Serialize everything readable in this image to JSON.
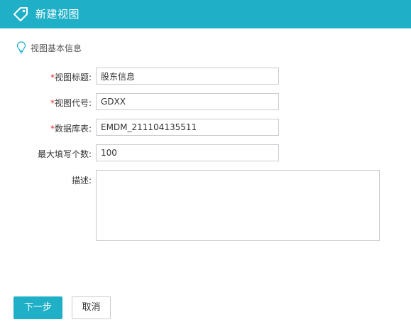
{
  "header": {
    "title": "新建视图",
    "icon": "tag-icon"
  },
  "section": {
    "title": "视图基本信息",
    "icon": "lightbulb-icon"
  },
  "form": {
    "required_mark": "*",
    "view_title": {
      "label": "视图标题:",
      "required": true,
      "value": "股东信息"
    },
    "view_code": {
      "label": "视图代号:",
      "required": true,
      "value": "GDXX"
    },
    "db_table": {
      "label": "数据库表:",
      "required": true,
      "value": "EMDM_211104135511"
    },
    "max_fill": {
      "label": "最大填写个数:",
      "required": false,
      "value": "100"
    },
    "description": {
      "label": "描述:",
      "required": false,
      "value": ""
    }
  },
  "buttons": {
    "next": "下一步",
    "cancel": "取消"
  },
  "colors": {
    "accent": "#1fb0c8",
    "required": "#e03030",
    "border": "#c8ccd0"
  }
}
